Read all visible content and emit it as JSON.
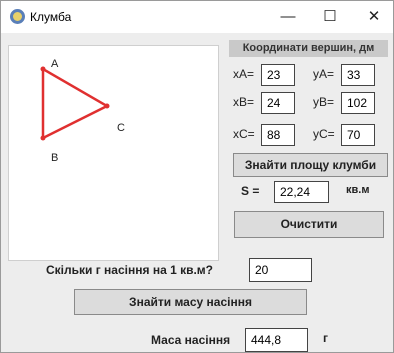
{
  "window": {
    "title": "Клумба",
    "minimize": "—",
    "maximize": "☐",
    "close": "✕"
  },
  "icons": {
    "app": "flower-icon"
  },
  "triangle": {
    "label_a": "A",
    "label_b": "B",
    "label_c": "C",
    "color": "#e03030",
    "dot_color": "#e03030"
  },
  "coords": {
    "header": "Координати вершин, дм",
    "xa_label": "xA=",
    "xa_value": "23",
    "ya_label": "yA=",
    "ya_value": "33",
    "xb_label": "xB=",
    "xb_value": "24",
    "yb_label": "yB=",
    "yb_value": "102",
    "xc_label": "xC=",
    "xc_value": "88",
    "yc_label": "yC=",
    "yc_value": "70"
  },
  "area": {
    "button": "Знайти площу клумби",
    "s_label": "S =",
    "s_value": "22,24",
    "unit": "кв.м"
  },
  "clear_button": "Очистити",
  "seeds": {
    "question": "Скільки г насіння на 1 кв.м?",
    "value": "20",
    "button": "Знайти масу насіння",
    "mass_label": "Маса насіння",
    "mass_value": "444,8",
    "mass_unit": "г"
  }
}
